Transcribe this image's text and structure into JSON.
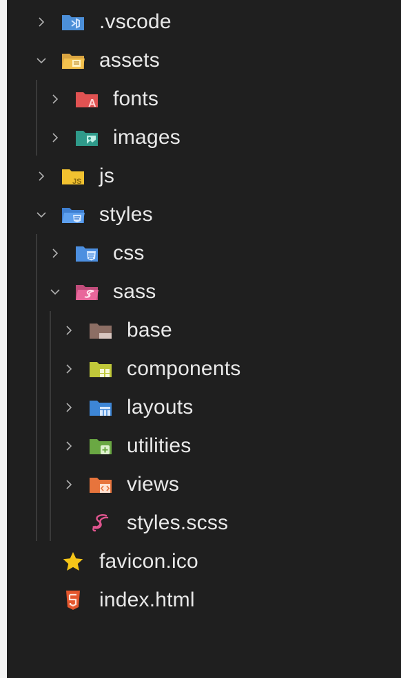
{
  "explorer": {
    "items": [
      {
        "label": ".vscode",
        "icon": "vscode-folder-icon",
        "expanded": false
      },
      {
        "label": "assets",
        "icon": "assets-folder-icon",
        "expanded": true
      },
      {
        "label": "fonts",
        "icon": "fonts-folder-icon",
        "expanded": false
      },
      {
        "label": "images",
        "icon": "images-folder-icon",
        "expanded": false
      },
      {
        "label": "js",
        "icon": "js-folder-icon",
        "expanded": false
      },
      {
        "label": "styles",
        "icon": "styles-folder-icon",
        "expanded": true
      },
      {
        "label": "css",
        "icon": "css-folder-icon",
        "expanded": false
      },
      {
        "label": "sass",
        "icon": "sass-folder-icon",
        "expanded": true
      },
      {
        "label": "base",
        "icon": "base-folder-icon",
        "expanded": false
      },
      {
        "label": "components",
        "icon": "components-folder-icon",
        "expanded": false
      },
      {
        "label": "layouts",
        "icon": "layouts-folder-icon",
        "expanded": false
      },
      {
        "label": "utilities",
        "icon": "utilities-folder-icon",
        "expanded": false
      },
      {
        "label": "views",
        "icon": "views-folder-icon",
        "expanded": false
      },
      {
        "label": "styles.scss",
        "icon": "sass-file-icon"
      },
      {
        "label": "favicon.ico",
        "icon": "star-icon"
      },
      {
        "label": "index.html",
        "icon": "html5-icon"
      }
    ]
  },
  "colors": {
    "background": "#1f1f1f",
    "text": "#e8e8e8",
    "chevron": "#b0b0b0",
    "guide": "#3a3a3a"
  }
}
